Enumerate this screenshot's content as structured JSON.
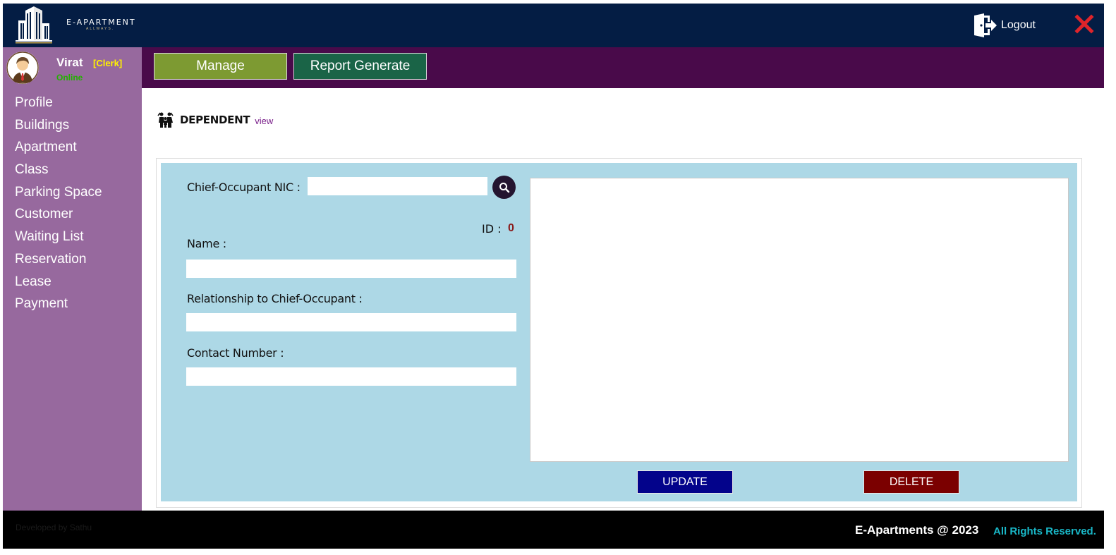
{
  "header": {
    "brand": "E-APARTMENT",
    "brand_sub": "ALLWAYS.",
    "logout_label": "Logout"
  },
  "user": {
    "name": "Virat",
    "role": "[Clerk]",
    "status": "Online"
  },
  "top_tabs": {
    "manage": "Manage",
    "report": "Report Generate"
  },
  "sidebar": {
    "items": [
      "Profile",
      "Buildings",
      "Apartment",
      "Class",
      "Parking Space",
      "Customer",
      "Waiting List",
      "Reservation",
      "Lease",
      "Payment"
    ]
  },
  "page": {
    "title": "DEPENDENT",
    "link": "view"
  },
  "form": {
    "nic_label": "Chief-Occupant NIC :",
    "nic_value": "",
    "id_label": "ID :",
    "id_value": "0",
    "name_label": "Name :",
    "name_value": "",
    "relationship_label": "Relationship to Chief-Occupant :",
    "relationship_value": "",
    "contact_label": "Contact Number :",
    "contact_value": ""
  },
  "actions": {
    "update": "UPDATE",
    "delete": "DELETE"
  },
  "footer": {
    "developer": "Developed by Sathu",
    "copyright": "E-Apartments @ 2023",
    "rights": "All Rights Reserved."
  },
  "colors": {
    "header": "#041d44",
    "subheader": "#490a4a",
    "sidebar": "#97699e",
    "panel": "#add8e6",
    "manage_button": "#7d9a32",
    "report_button": "#1a6447",
    "update_button": "#03038b",
    "delete_button": "#7b0000",
    "close_icon": "#e0242a"
  }
}
